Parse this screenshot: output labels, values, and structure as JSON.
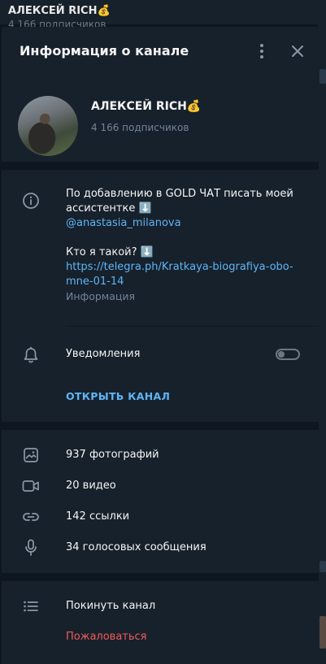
{
  "background": {
    "chat_title": "АЛЕКСЕЙ RICH💰",
    "chat_subtitle": "4 166 подписчиков"
  },
  "panel": {
    "title": "Информация о канале",
    "more_icon": "more-vertical-icon",
    "close_icon": "close-icon"
  },
  "channel": {
    "name": "АЛЕКСЕЙ RICH💰",
    "subscribers": "4 166 подписчиков"
  },
  "info": {
    "desc_line1": "По добавлению в GOLD ЧАТ писать моей",
    "desc_line2": "ассистентке ⬇️",
    "mention": "@anastasia_milanova",
    "question": "Кто я такой? ⬇️",
    "url_line1": "https://telegra.ph/Kratkaya-biografiya-obo-",
    "url_line2": "mne-01-14",
    "label": "Информация"
  },
  "notifications": {
    "label": "Уведомления",
    "enabled": false
  },
  "open_channel": "ОТКРЫТЬ КАНАЛ",
  "media": {
    "photos": "937 фотографий",
    "videos": "20 видео",
    "links": "142 ссылки",
    "voice": "34 голосовых сообщения"
  },
  "actions": {
    "leave": "Покинуть канал",
    "report": "Пожаловаться"
  },
  "colors": {
    "panel_bg": "#17212b",
    "page_bg": "#0e1621",
    "accent": "#5eb5f7",
    "danger": "#ef5b5b",
    "muted": "#708499"
  }
}
